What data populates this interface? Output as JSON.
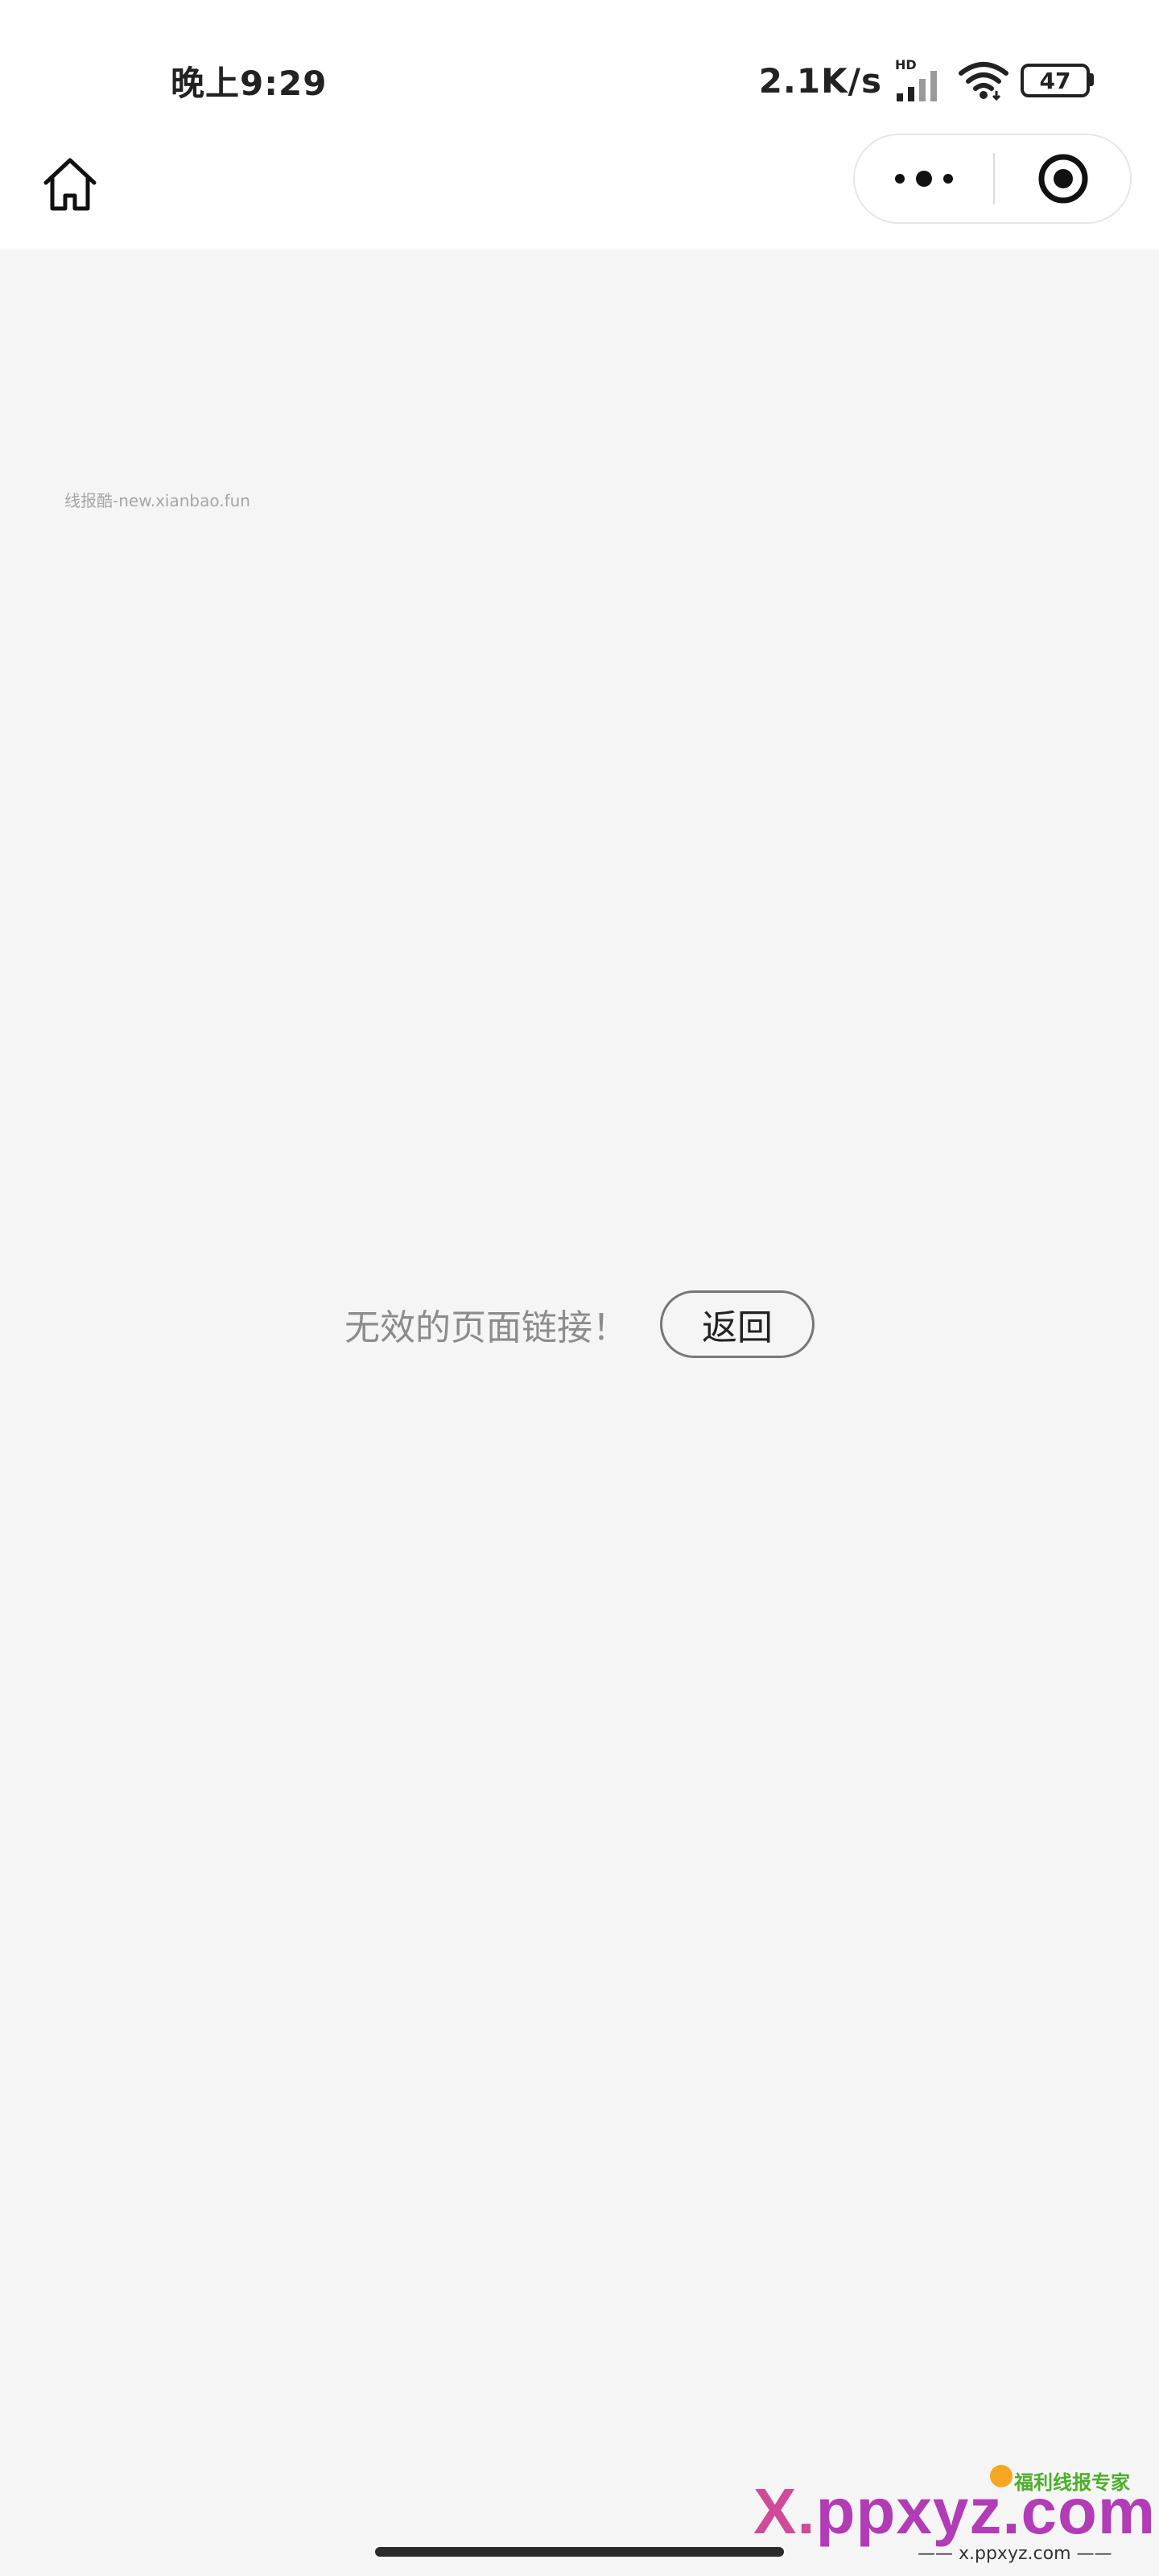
{
  "status_bar": {
    "time": "晚上9:29",
    "net_speed": "2.1K/s",
    "hd_label": "HD",
    "battery_level": "47"
  },
  "nav": {
    "home_icon": "home-icon",
    "more_icon": "more-dots-icon",
    "close_icon": "target-circle-icon"
  },
  "content": {
    "watermark": "线报酷-new.xianbao.fun",
    "error_message": "无效的页面链接！",
    "back_label": "返回"
  },
  "brand_watermark": {
    "main_x": "X.",
    "main_rest": "ppxyz.com",
    "tagline": "福利线报专家",
    "sub": "—— x.ppxyz.com ——"
  },
  "colors": {
    "background": "#f5f5f5",
    "bar_background": "#ffffff",
    "error_text": "#8c8c8c",
    "brand": "#b23cb6"
  }
}
